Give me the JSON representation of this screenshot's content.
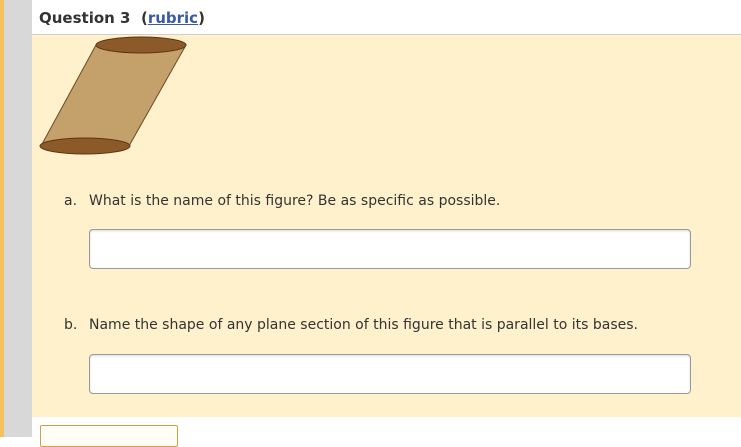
{
  "question": {
    "title": "Question 3",
    "rubric_link": "rubric"
  },
  "items": [
    {
      "letter": "a.",
      "text": "What is the name of this figure? Be as specific as possible.",
      "answer": ""
    },
    {
      "letter": "b.",
      "text": "Name the shape of any plane section of this figure that is parallel to its bases.",
      "answer": ""
    }
  ],
  "footer": {
    "button_label": ""
  },
  "colors": {
    "panel_bg": "#fff1cc",
    "cylinder_body": "#c4a06a",
    "cylinder_base": "#8b5a28",
    "link": "#3a5aa8"
  }
}
